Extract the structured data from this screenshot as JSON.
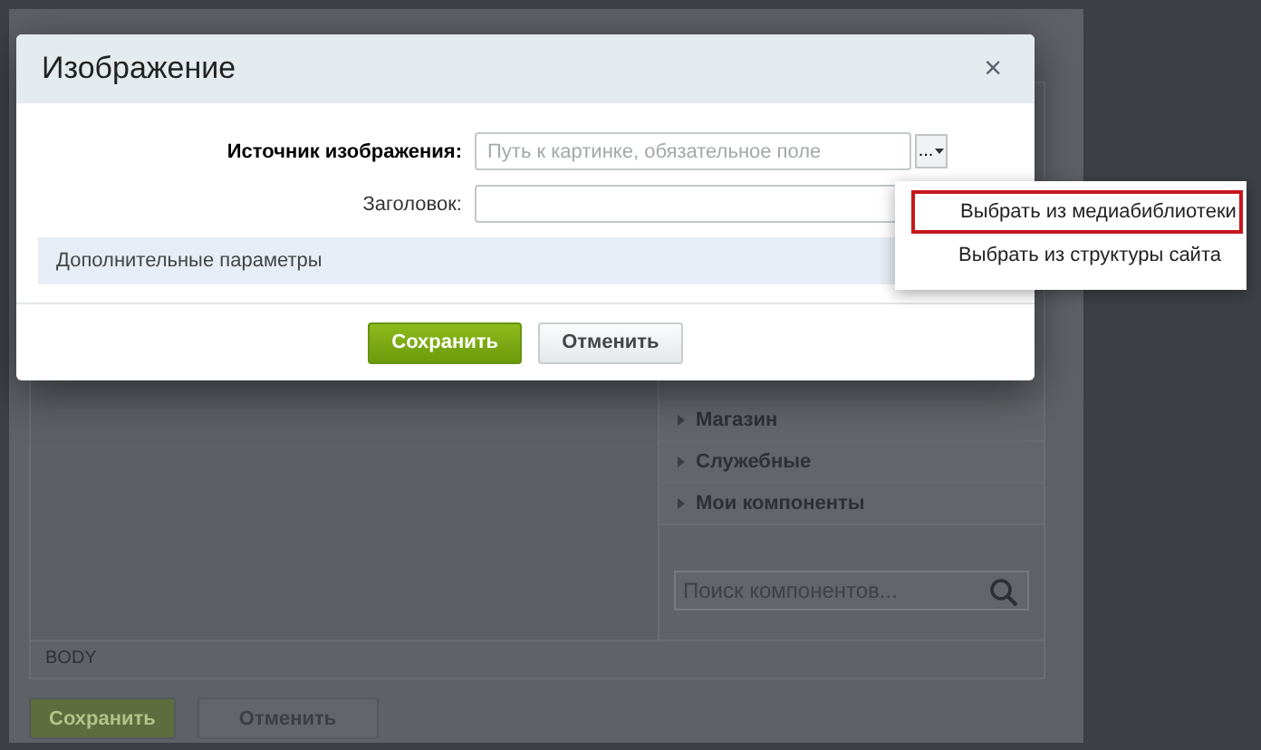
{
  "background_window": {
    "component_groups": [
      {
        "label": "Магазин"
      },
      {
        "label": "Служебные"
      },
      {
        "label": "Мои компоненты"
      }
    ],
    "search": {
      "placeholder": "Поиск компонентов..."
    },
    "path": "BODY",
    "buttons": [
      {
        "label": "Сохранить",
        "kind": "primary"
      },
      {
        "label": "Отменить",
        "kind": "secondary"
      }
    ]
  },
  "dialog": {
    "title": "Изображение",
    "close": "×",
    "fields": [
      {
        "label": "Источник изображения:",
        "placeholder": "Путь к картинке, обязательное поле",
        "required": true,
        "browse": "..."
      },
      {
        "label": "Заголовок:",
        "required": false
      }
    ],
    "section": "Дополнительные параметры",
    "buttons": [
      {
        "label": "Сохранить",
        "kind": "primary"
      },
      {
        "label": "Отменить",
        "kind": "secondary"
      }
    ]
  },
  "menu": {
    "items": [
      {
        "label": "Выбрать из медиабиблиотеки",
        "selected": true
      },
      {
        "label": "Выбрать из структуры сайта",
        "selected": false
      }
    ]
  }
}
